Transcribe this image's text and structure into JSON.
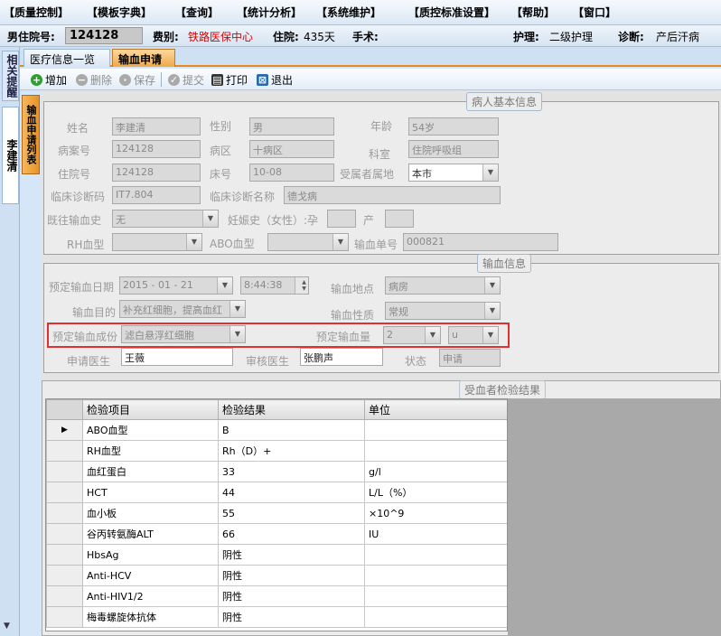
{
  "menu": [
    "【质量控制】",
    "【模板字典】",
    "【查询】",
    "【统计分析】",
    "【系统维护】",
    "【质控标准设置】",
    "【帮助】",
    "【窗口】"
  ],
  "patient": {
    "id_label": "男住院号:",
    "id": "124128",
    "category_label": "费别:",
    "category": "铁路医保中心",
    "stay_label": "住院:",
    "stay": "435天",
    "surgery_label": "手术:",
    "nursing_label": "护理:",
    "nursing": "二级护理",
    "diagnosis_label": "诊断:",
    "diagnosis": "产后汗病"
  },
  "side": {
    "remind": "相关提醒",
    "patient_name": "李建清",
    "list_tab": "输血申请列表"
  },
  "tabs": [
    "医疗信息一览表",
    "输血申请"
  ],
  "toolbar": {
    "add": "增加",
    "delete": "删除",
    "save": "保存",
    "submit": "提交",
    "print": "打印",
    "exit": "退出"
  },
  "basic": {
    "legend": "病人基本信息",
    "name_label": "姓名",
    "name": "李建清",
    "sex_label": "性别",
    "sex": "男",
    "age_label": "年龄",
    "age": "54岁",
    "case_label": "病案号",
    "case_no": "124128",
    "ward_label": "病区",
    "ward": "十病区",
    "dept_label": "科室",
    "dept": "住院呼吸组",
    "inpatient_label": "住院号",
    "inpatient_no": "124128",
    "bed_label": "床号",
    "bed": "10-08",
    "region_label": "受属者属地",
    "region": "本市",
    "diag_code_label": "临床诊断码",
    "diag_code": "IT7.804",
    "diag_name_label": "临床诊断名称",
    "diag_name": "德戈病",
    "history_label": "既往输血史",
    "history": "无",
    "preg_label": "妊娠史（女性）:孕",
    "birth_label": "产",
    "rh_label": "RH血型",
    "abo_label": "ABO血型",
    "order_label": "输血单号",
    "order_no": "000821"
  },
  "transfusion": {
    "legend": "输血信息",
    "date_label": "预定输血日期",
    "date": "2015 - 01 - 21",
    "time": "8:44:38",
    "place_label": "输血地点",
    "place": "病房",
    "purpose_label": "输血目的",
    "purpose": "补充红细胞，提高血红",
    "nature_label": "输血性质",
    "nature": "常规",
    "component_label": "预定输血成份",
    "component": "滤白悬浮红细胞",
    "amount_label": "预定输血量",
    "amount": "2",
    "unit": "u",
    "doctor_label": "申请医生",
    "doctor": "王薇",
    "reviewer_label": "审核医生",
    "reviewer": "张鹏声",
    "status_label": "状态",
    "status": "申请"
  },
  "lab": {
    "legend": "受血者检验结果",
    "headers": [
      "检验项目",
      "检验结果",
      "单位"
    ],
    "rows": [
      [
        "ABO血型",
        "B",
        ""
      ],
      [
        "RH血型",
        "Rh（D）+",
        ""
      ],
      [
        "血红蛋白",
        "33",
        "g/l"
      ],
      [
        "HCT",
        "44",
        "L/L（%）"
      ],
      [
        "血小板",
        "55",
        "×10^9"
      ],
      [
        "谷丙转氨酶ALT",
        "66",
        "IU"
      ],
      [
        "HbsAg",
        "阴性",
        ""
      ],
      [
        "Anti-HCV",
        "阴性",
        ""
      ],
      [
        "Anti-HIV1/2",
        "阴性",
        ""
      ],
      [
        "梅毒螺旋体抗体",
        "阴性",
        ""
      ]
    ]
  }
}
